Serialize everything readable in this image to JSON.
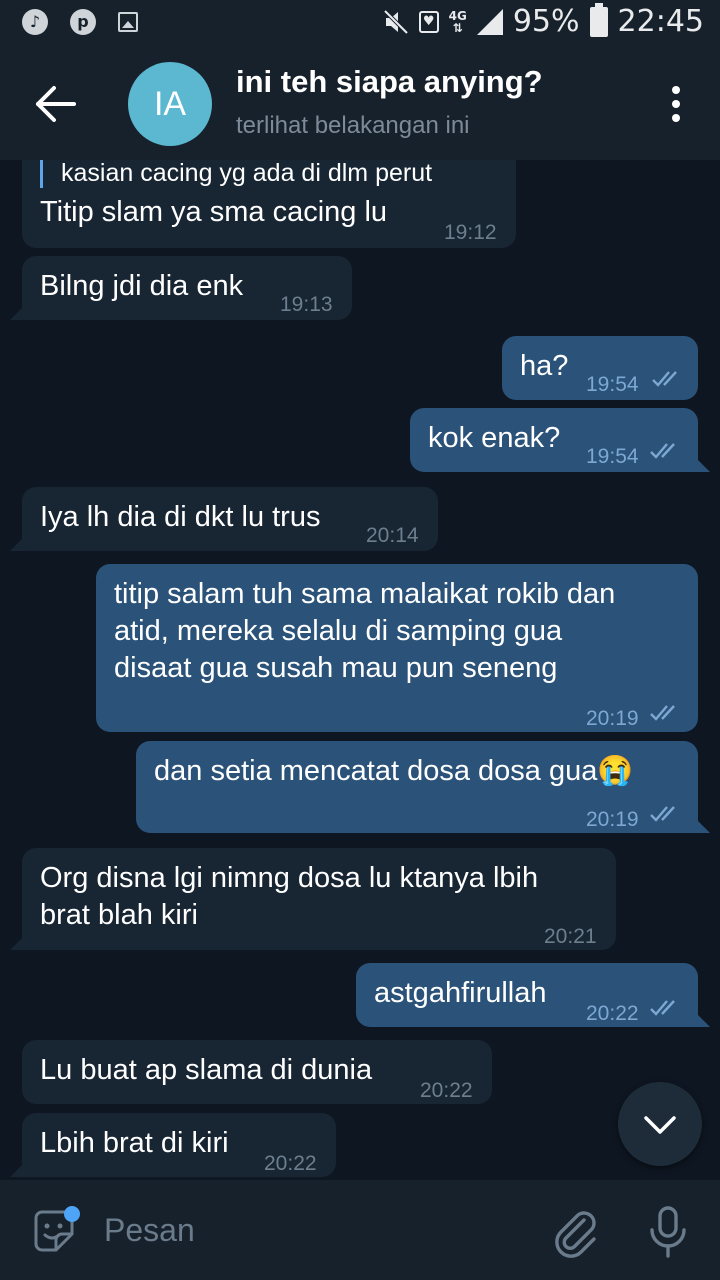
{
  "status_bar": {
    "battery": "95%",
    "time": "22:45",
    "network": "4G"
  },
  "header": {
    "avatar_initials": "IA",
    "title": "ini teh siapa anying?",
    "subtitle": "terlihat belakangan ini"
  },
  "messages": [
    {
      "direction": "in",
      "reply_quote": "kasian cacing yg ada di dlm perut",
      "text": "Titip slam ya sma cacing lu",
      "time": "19:12"
    },
    {
      "direction": "in",
      "text": "Bilng jdi dia enk",
      "time": "19:13"
    },
    {
      "direction": "out",
      "text": "ha?",
      "time": "19:54",
      "read": true
    },
    {
      "direction": "out",
      "text": "kok enak?",
      "time": "19:54",
      "read": true
    },
    {
      "direction": "in",
      "text": "Iya lh dia di dkt lu trus",
      "time": "20:14"
    },
    {
      "direction": "out",
      "text_lines": [
        "titip salam tuh sama malaikat rokib dan",
        "atid, mereka selalu di samping gua",
        "disaat gua susah mau pun seneng"
      ],
      "time": "20:19",
      "read": true
    },
    {
      "direction": "out",
      "text": "dan setia mencatat dosa dosa gua😭",
      "time": "20:19",
      "read": true
    },
    {
      "direction": "in",
      "text_lines": [
        "Org disna lgi nimng dosa lu ktanya lbih",
        "brat blah kiri"
      ],
      "time": "20:21"
    },
    {
      "direction": "out",
      "text": "astgahfirullah",
      "time": "20:22",
      "read": true
    },
    {
      "direction": "in",
      "text": "Lu buat ap slama di dunia",
      "time": "20:22"
    },
    {
      "direction": "in",
      "text": "Lbih brat di kiri",
      "time": "20:22"
    }
  ],
  "input": {
    "placeholder": "Pesan"
  },
  "colors": {
    "background": "#0e1621",
    "bar": "#17212b",
    "incoming_bubble": "#182533",
    "outgoing_bubble": "#2b5278",
    "accent": "#4ea4f6"
  }
}
